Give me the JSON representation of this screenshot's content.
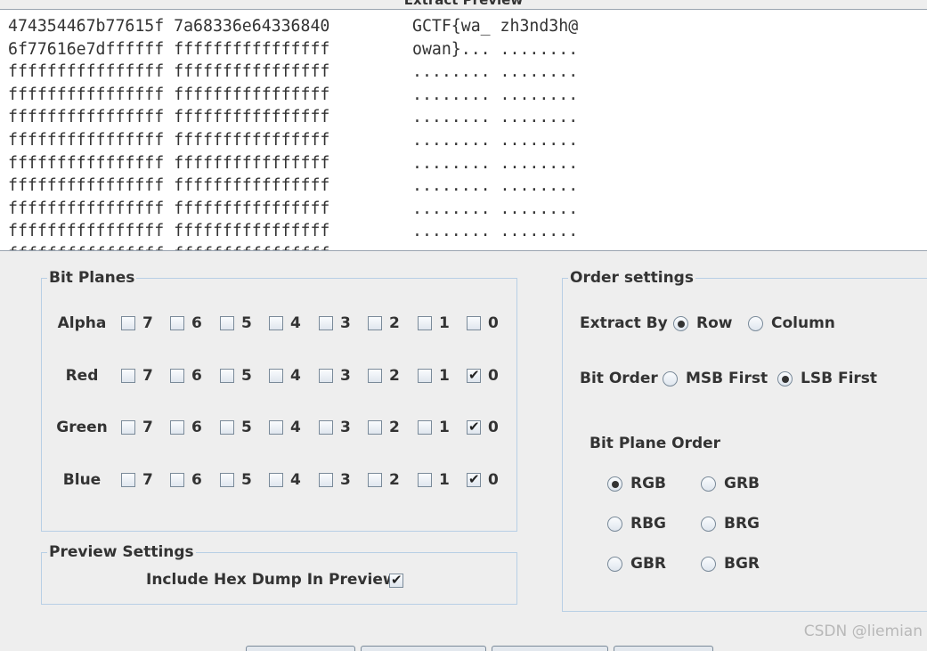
{
  "preview": {
    "title": "Extract Preview",
    "hex_lines": [
      "474354467b77615f 7a68336e64336840",
      "6f77616e7dffffff ffffffffffffffff",
      "ffffffffffffffff ffffffffffffffff",
      "ffffffffffffffff ffffffffffffffff",
      "ffffffffffffffff ffffffffffffffff",
      "ffffffffffffffff ffffffffffffffff",
      "ffffffffffffffff ffffffffffffffff",
      "ffffffffffffffff ffffffffffffffff",
      "ffffffffffffffff ffffffffffffffff",
      "ffffffffffffffff ffffffffffffffff",
      "ffffffffffffffff ffffffffffffffff"
    ],
    "ascii_lines": [
      "GCTF{wa_ zh3nd3h@",
      "owan}... ........",
      "........ ........",
      "........ ........",
      "........ ........",
      "........ ........",
      "........ ........",
      "........ ........",
      "........ ........",
      "........ ........",
      "........ ........"
    ]
  },
  "bit_planes": {
    "title": "Bit Planes",
    "bits": [
      "7",
      "6",
      "5",
      "4",
      "3",
      "2",
      "1",
      "0"
    ],
    "channels": [
      {
        "name": "Alpha",
        "checked": [
          false,
          false,
          false,
          false,
          false,
          false,
          false,
          false
        ]
      },
      {
        "name": "Red",
        "checked": [
          false,
          false,
          false,
          false,
          false,
          false,
          false,
          true
        ]
      },
      {
        "name": "Green",
        "checked": [
          false,
          false,
          false,
          false,
          false,
          false,
          false,
          true
        ]
      },
      {
        "name": "Blue",
        "checked": [
          false,
          false,
          false,
          false,
          false,
          false,
          false,
          true
        ]
      }
    ]
  },
  "preview_settings": {
    "title": "Preview Settings",
    "hex_dump_label": "Include Hex Dump In Preview",
    "hex_dump_checked": true
  },
  "order_settings": {
    "title": "Order settings",
    "extract_by": {
      "label": "Extract By",
      "options": [
        "Row",
        "Column"
      ],
      "selected": "Row"
    },
    "bit_order": {
      "label": "Bit Order",
      "options": [
        "MSB First",
        "LSB First"
      ],
      "selected": "LSB First"
    },
    "bit_plane_order": {
      "label": "Bit Plane Order",
      "options": [
        "RGB",
        "GRB",
        "RBG",
        "BRG",
        "GBR",
        "BGR"
      ],
      "selected": "RGB"
    }
  },
  "watermark": "CSDN @liemian",
  "icons": {
    "check": "✔"
  }
}
